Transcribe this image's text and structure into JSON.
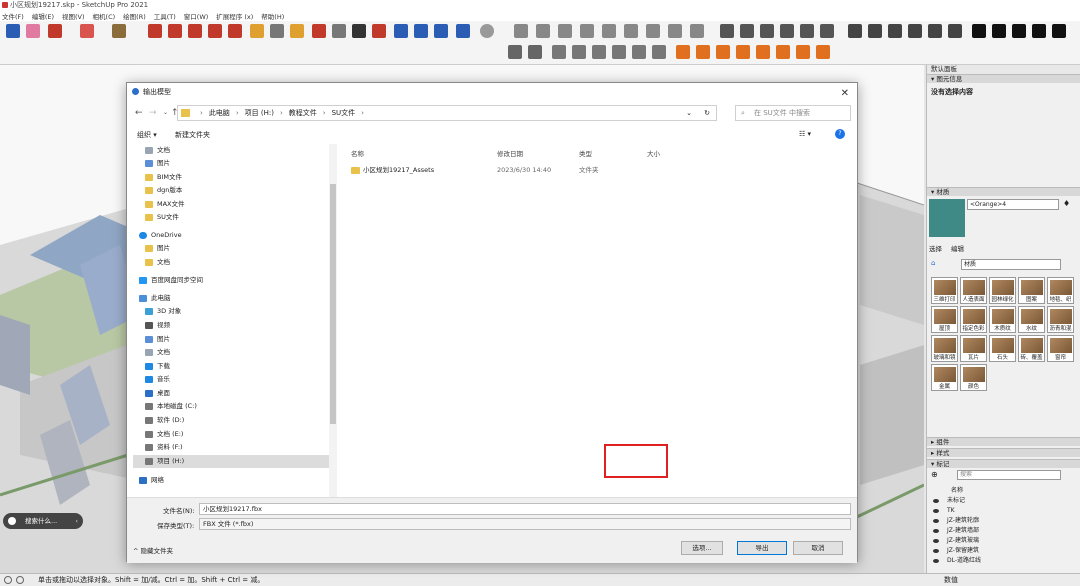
{
  "window": {
    "title": "小区规划19217.skp - SketchUp Pro 2021"
  },
  "menu": [
    "文件(F)",
    "编辑(E)",
    "视图(V)",
    "相机(C)",
    "绘图(R)",
    "工具(T)",
    "窗口(W)",
    "扩展程序 (x)",
    "帮助(H)"
  ],
  "dialog": {
    "title": "输出模型",
    "path": [
      "此电脑",
      "项目 (H:)",
      "教程文件",
      "SU文件"
    ],
    "search_placeholder": "在 SU文件 中搜索",
    "organize": "组织 ▾",
    "new_folder": "新建文件夹",
    "nav_items": [
      "文档",
      "图片",
      "BIM文件",
      "dgn版本",
      "MAX文件",
      "SU文件",
      "OneDrive",
      "图片",
      "文档",
      "百度网盘同步空间",
      "此电脑",
      "3D 对象",
      "视频",
      "图片",
      "文档",
      "下载",
      "音乐",
      "桌面",
      "本地磁盘 (C:)",
      "软件 (D:)",
      "文档 (E:)",
      "资料 (F:)",
      "项目 (H:)",
      "网络"
    ],
    "columns": [
      "名称",
      "修改日期",
      "类型",
      "大小"
    ],
    "files": [
      {
        "name": "小区规划19217_Assets",
        "date": "2023/6/30 14:40",
        "type": "文件夹"
      }
    ],
    "filename_label": "文件名(N):",
    "filename_value": "小区规划19217.fbx",
    "filetype_label": "保存类型(T):",
    "filetype_value": "FBX 文件 (*.fbx)",
    "hide_folders": "隐藏文件夹",
    "options_btn": "选项...",
    "export_btn": "导出",
    "cancel_btn": "取消"
  },
  "right_panel": {
    "tray_title": "默认面板",
    "entity_info": "图元信息",
    "no_selection": "没有选择内容",
    "materials": "材质",
    "material_name": "<Orange>4",
    "tab_select": "选择",
    "tab_edit": "编辑",
    "library": "材质",
    "material_items": [
      "三维打印",
      "人造表面",
      "园林绿化",
      "图案",
      "地毯、织",
      "屋顶",
      "指定色彩",
      "木质纹",
      "水纹",
      "沥青和混",
      "玻璃和镜",
      "瓦片",
      "石头",
      "砖、覆盖",
      "窗帘",
      "金属",
      "颜色"
    ],
    "components": "组件",
    "styles": "样式",
    "tags": "标记",
    "tag_search": "搜索",
    "tag_name_col": "名称",
    "tags_list": [
      "未标记",
      "TK",
      "JZ-建筑轮廓",
      "JZ-建筑墙部",
      "JZ-建筑玻璃",
      "JZ-保留建筑",
      "DL-道路红线"
    ]
  },
  "status": {
    "text": "单击或拖动以选择对象。Shift = 加/减。Ctrl = 加。Shift + Ctrl = 减。",
    "measure": "数值"
  },
  "search_pill": "搜索什么..."
}
